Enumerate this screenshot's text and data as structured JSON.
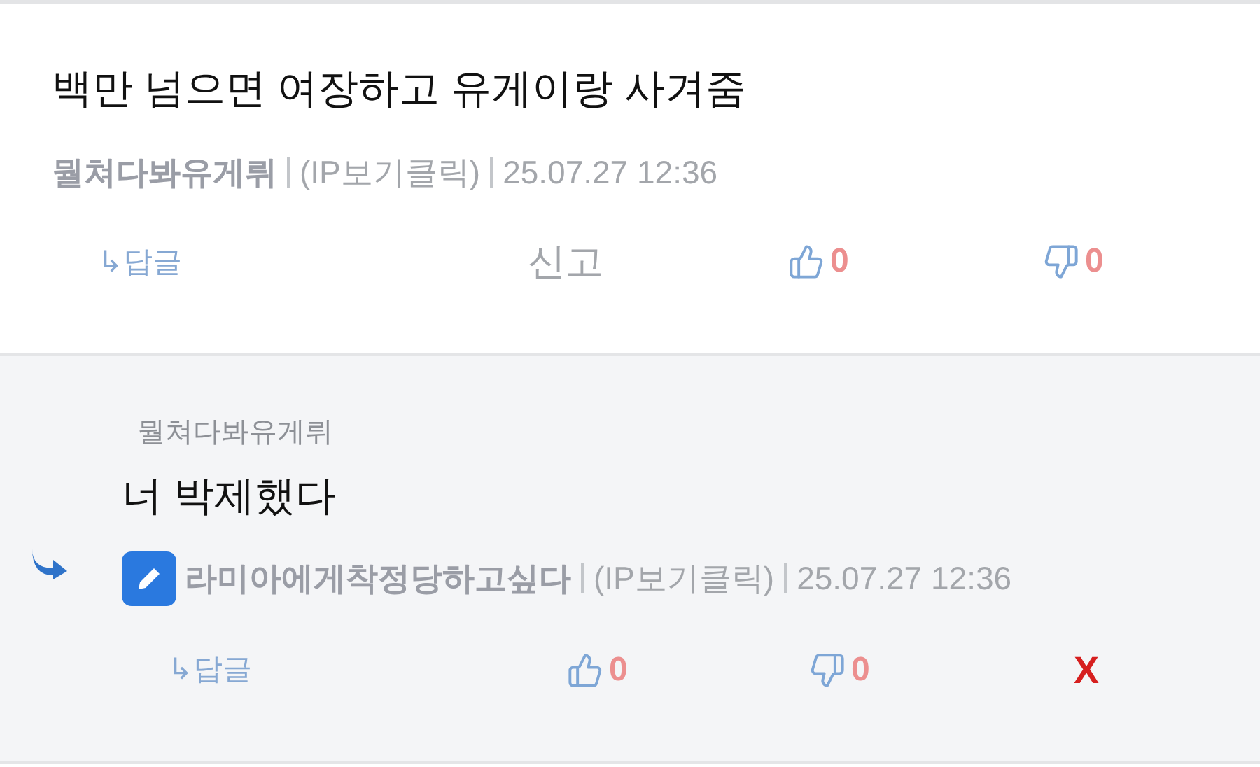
{
  "comment": {
    "text": "백만 넘으면 여장하고 유게이랑 사겨줌",
    "author": "뭘쳐다봐유게뤼",
    "ip": "(IP보기클릭)",
    "date": "25.07.27 12:36",
    "reply_link": "↳답글",
    "report": "신고",
    "likes": "0",
    "dislikes": "0"
  },
  "reply": {
    "quoted_author": "뭘쳐다봐유게뤼",
    "text": "너 박제했다",
    "author": "라미아에게착정당하고싶다",
    "ip": "(IP보기클릭)",
    "date": "25.07.27 12:36",
    "reply_link": "↳답글",
    "likes": "0",
    "dislikes": "0",
    "delete": "X"
  }
}
